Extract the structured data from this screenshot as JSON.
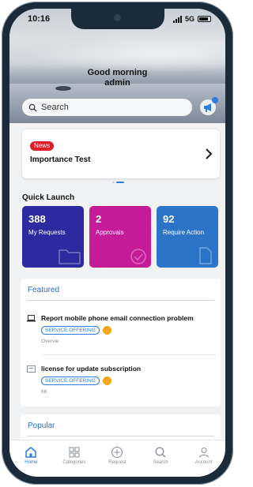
{
  "status_bar": {
    "time": "10:16",
    "network": "5G"
  },
  "header": {
    "greeting": "Good morning",
    "user": "admin"
  },
  "search": {
    "placeholder": "Search"
  },
  "news_card": {
    "tag": "News",
    "title": "Importance Test"
  },
  "quick_launch": {
    "title": "Quick Launch",
    "tiles": [
      {
        "count": "388",
        "label": "My Requests",
        "color": "#2c2a9e"
      },
      {
        "count": "2",
        "label": "Approvals",
        "color": "#c61b98"
      },
      {
        "count": "92",
        "label": "Require Action",
        "color": "#2b74c7"
      }
    ]
  },
  "featured": {
    "title": "Featured",
    "items": [
      {
        "icon": "laptop-icon",
        "title": "Report mobile phone email connection problem",
        "tag": "SERVICE OFFERING",
        "subtitle": "Overvie"
      },
      {
        "icon": "document-icon",
        "title": "license for update subscription",
        "tag": "SERVICE OFFERING",
        "subtitle": "66"
      }
    ]
  },
  "popular": {
    "title": "Popular"
  },
  "tabbar": {
    "tabs": [
      {
        "label": "Home",
        "icon": "home-icon",
        "active": true
      },
      {
        "label": "Categories",
        "icon": "grid-icon",
        "active": false
      },
      {
        "label": "Request",
        "icon": "plus-circle-icon",
        "active": false
      },
      {
        "label": "Search",
        "icon": "search-icon",
        "active": false
      },
      {
        "label": "Account",
        "icon": "user-icon",
        "active": false
      }
    ]
  },
  "colors": {
    "accent": "#2a7de1",
    "news_tag": "#e01f2b",
    "star": "#f1a81b"
  }
}
